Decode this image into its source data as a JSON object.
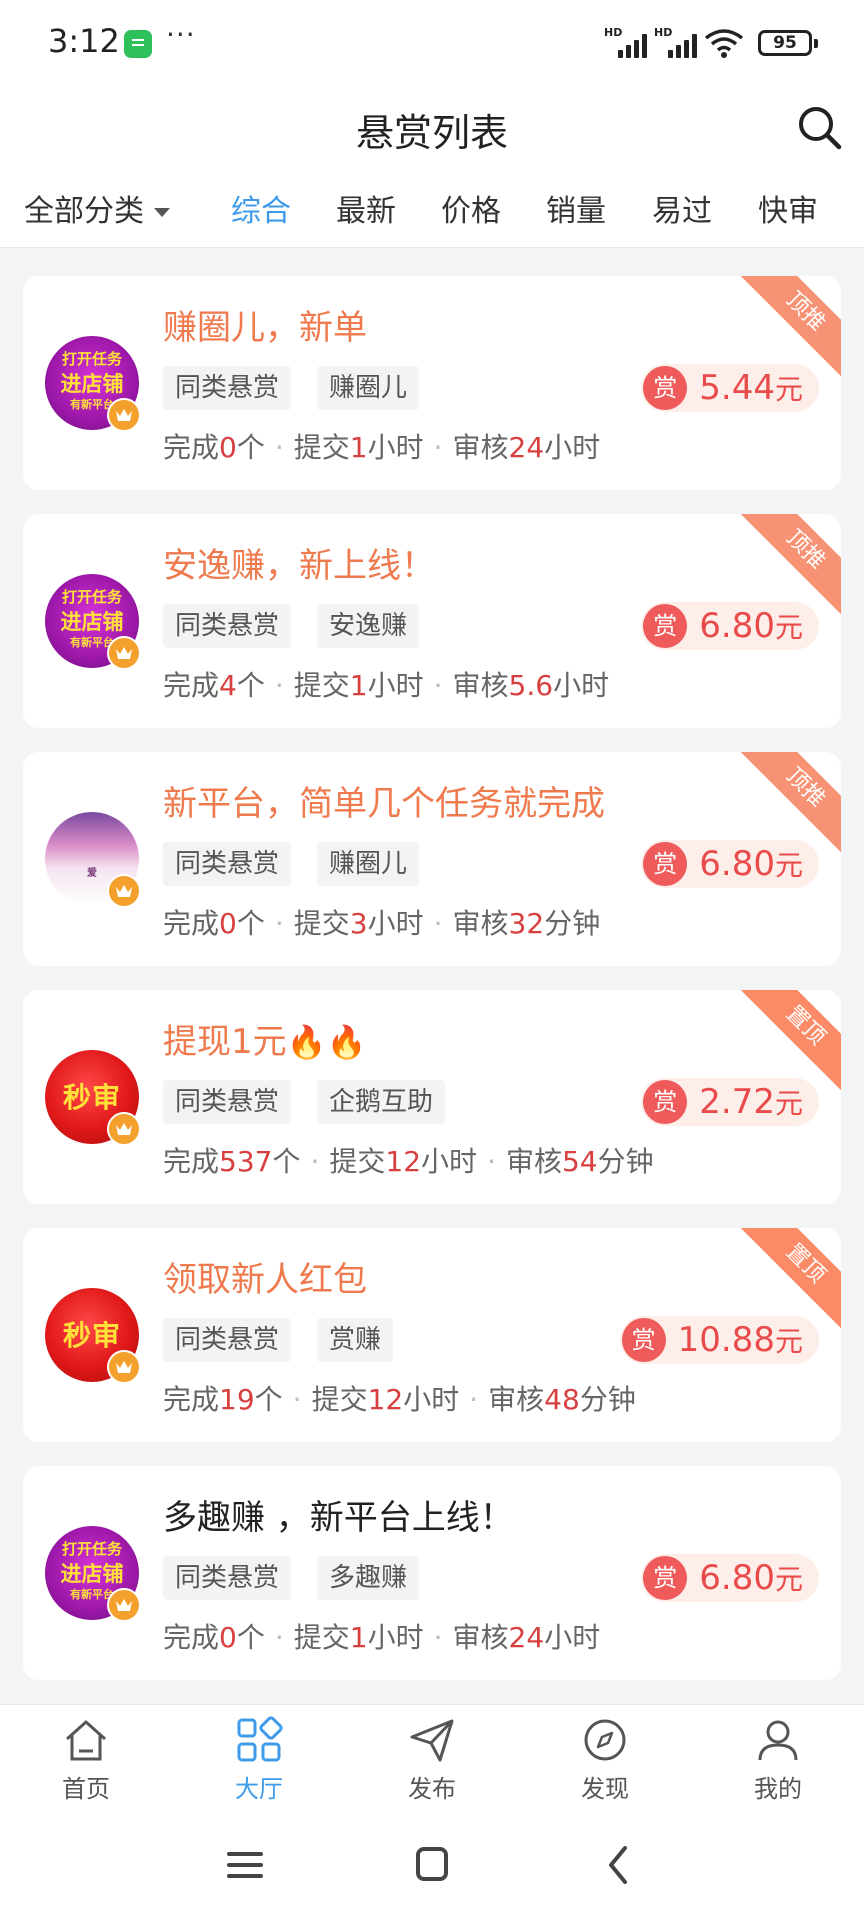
{
  "status_bar": {
    "time": "3:12",
    "dots": "···",
    "signal_label": "HD",
    "battery": "95"
  },
  "header": {
    "title": "悬赏列表"
  },
  "filters": {
    "category": "全部分类",
    "sorts": [
      "综合",
      "最新",
      "价格",
      "销量",
      "易过",
      "快审"
    ],
    "active_sort": "综合"
  },
  "labels": {
    "done": "完成",
    "submit": "提交",
    "review": "审核",
    "count_unit": "个",
    "reward_icon": "赏",
    "reward_unit": "元"
  },
  "tasks": [
    {
      "title": "赚圈儿，新单",
      "tag1": "同类悬赏",
      "tag2": "赚圈儿",
      "reward": "5.44",
      "done": "0",
      "submit_val": "1",
      "submit_unit": "小时",
      "review_val": "24",
      "review_unit": "小时",
      "ribbon": "顶推",
      "avatar": "promo",
      "avatar_text": [
        "打开任务",
        "进店铺",
        "有新平台"
      ]
    },
    {
      "title": "安逸赚，新上线！",
      "tag1": "同类悬赏",
      "tag2": "安逸赚",
      "reward": "6.80",
      "done": "4",
      "submit_val": "1",
      "submit_unit": "小时",
      "review_val": "5.6",
      "review_unit": "小时",
      "ribbon": "顶推",
      "avatar": "promo",
      "avatar_text": [
        "打开任务",
        "进店铺",
        "有新平台"
      ]
    },
    {
      "title": "新平台，简单几个任务就完成",
      "tag1": "同类悬赏",
      "tag2": "赚圈儿",
      "reward": "6.80",
      "done": "0",
      "submit_val": "3",
      "submit_unit": "小时",
      "review_val": "32",
      "review_unit": "分钟",
      "ribbon": "顶推",
      "avatar": "photo",
      "avatar_text": [
        "爱"
      ]
    },
    {
      "title": "提现1元",
      "title_emoji": "🔥🔥",
      "tag1": "同类悬赏",
      "tag2": "企鹅互助",
      "reward": "2.72",
      "done": "537",
      "submit_val": "12",
      "submit_unit": "小时",
      "review_val": "54",
      "review_unit": "分钟",
      "ribbon": "置顶",
      "avatar": "fast",
      "avatar_text": [
        "秒审"
      ]
    },
    {
      "title": "领取新人红包",
      "tag1": "同类悬赏",
      "tag2": "赏赚",
      "reward": "10.88",
      "done": "19",
      "submit_val": "12",
      "submit_unit": "小时",
      "review_val": "48",
      "review_unit": "分钟",
      "ribbon": "置顶",
      "avatar": "fast",
      "avatar_text": [
        "秒审"
      ]
    },
    {
      "title": "多趣赚 ，新平台上线！",
      "tag1": "同类悬赏",
      "tag2": "多趣赚",
      "reward": "6.80",
      "done": "0",
      "submit_val": "1",
      "submit_unit": "小时",
      "review_val": "24",
      "review_unit": "小时",
      "ribbon": "",
      "avatar": "promo",
      "avatar_text": [
        "打开任务",
        "进店铺",
        "有新平台"
      ]
    }
  ],
  "bottom_nav": [
    {
      "label": "首页",
      "icon": "home-icon"
    },
    {
      "label": "大厅",
      "icon": "grid-icon"
    },
    {
      "label": "发布",
      "icon": "send-icon"
    },
    {
      "label": "发现",
      "icon": "compass-icon"
    },
    {
      "label": "我的",
      "icon": "user-icon"
    }
  ],
  "active_nav": "大厅",
  "colors": {
    "accent": "#3d9be9",
    "title_orange": "#ef7a4e",
    "reward_red": "#e94b4b",
    "ribbon": "#f79274"
  }
}
